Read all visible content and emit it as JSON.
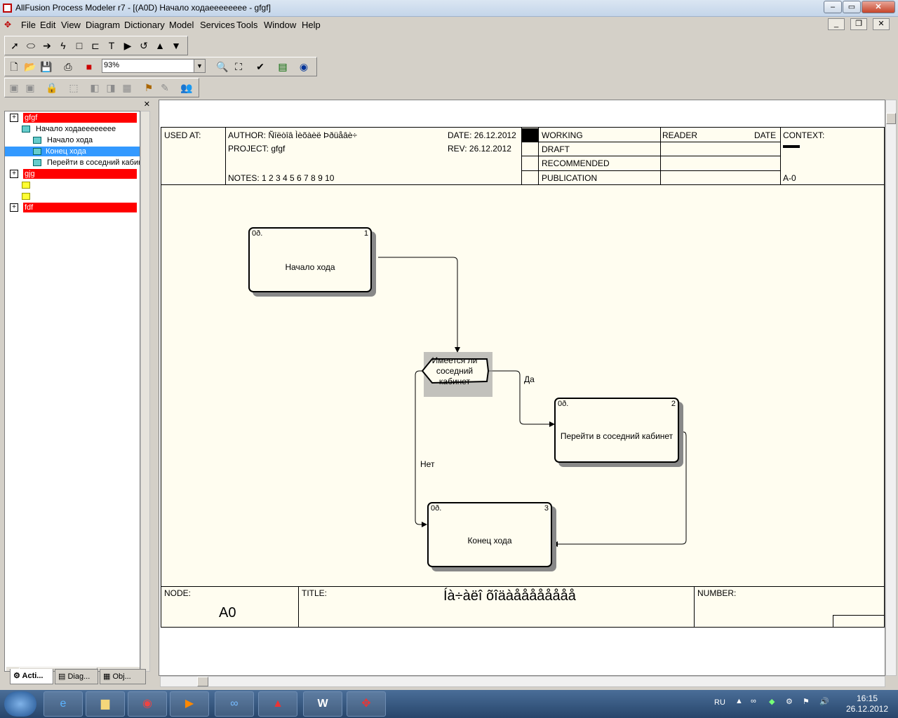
{
  "window": {
    "title": "AllFusion Process Modeler r7 - [(A0D) Начало ходаееееееее - gfgf]"
  },
  "menu": [
    "File",
    "Edit",
    "View",
    "Diagram",
    "Dictionary",
    "Model",
    "Services",
    "Tools",
    "Window",
    "Help"
  ],
  "toolbar": {
    "zoom": "93%"
  },
  "tree": {
    "model1": "gfgf",
    "diagram": "Начало ходаееееееее",
    "act1": "Начало хода",
    "act2": "Конец хода",
    "act3": "Перейти в соседний кабинет",
    "model2": "gjg",
    "model3": "fdf"
  },
  "tabs": [
    "Acti...",
    "Diag...",
    "Obj..."
  ],
  "header": {
    "used_at": "USED AT:",
    "author": "AUTHOR:  Ñîëòîâ Ìèõàèë Þðüåâè÷",
    "project": "PROJECT:  gfgf",
    "notes": "NOTES:  1  2  3  4  5  6  7  8  9  10",
    "date": "DATE:   26.12.2012",
    "rev": "REV:     26.12.2012",
    "working": "WORKING",
    "draft": "DRAFT",
    "recommended": "RECOMMENDED",
    "publication": "PUBLICATION",
    "reader": "READER",
    "date2": "DATE",
    "context": "CONTEXT:",
    "node_ref": "A-0"
  },
  "diagram": {
    "box1": {
      "cost": "0ð.",
      "num": "1",
      "label": "Начало хода"
    },
    "box2": {
      "cost": "0ð.",
      "num": "2",
      "label": "Перейти в соседний кабинет"
    },
    "box3": {
      "cost": "0ð.",
      "num": "3",
      "label": "Конец хода"
    },
    "junction": "Имеется ли соседний кабинет",
    "yes": "Да",
    "no": "Нет"
  },
  "footer": {
    "node_label": "NODE:",
    "node": "A0",
    "title_label": "TITLE:",
    "title": "Íà÷àëî õîäàåååååååå",
    "number_label": "NUMBER:"
  },
  "tray": {
    "lang": "RU",
    "time": "16:15",
    "date": "26.12.2012"
  }
}
